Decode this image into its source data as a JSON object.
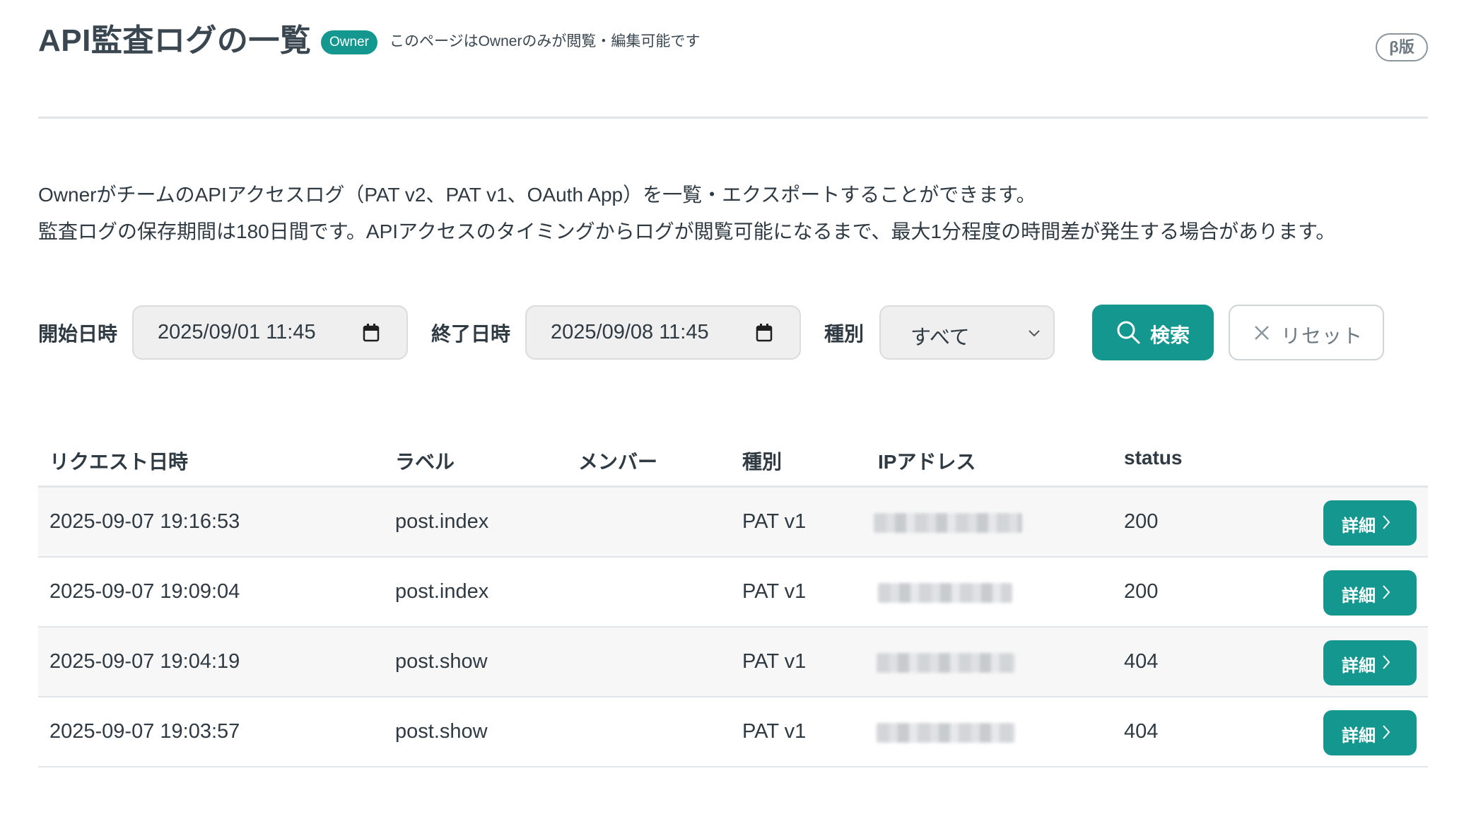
{
  "header": {
    "title": "API監査ログの一覧",
    "owner_badge": "Owner",
    "owner_note": "このページはOwnerのみが閲覧・編集可能です",
    "beta_badge": "β版"
  },
  "description": {
    "line1": "OwnerがチームのAPIアクセスログ（PAT v2、PAT v1、OAuth App）を一覧・エクスポートすることができます。",
    "line2": "監査ログの保存期間は180日間です。APIアクセスのタイミングからログが閲覧可能になるまで、最大1分程度の時間差が発生する場合があります。"
  },
  "filters": {
    "start_label": "開始日時",
    "start_value": "2025/09/01 11:45",
    "end_label": "終了日時",
    "end_value": "2025/09/08 11:45",
    "type_label": "種別",
    "type_value": "すべて",
    "search_label": "検索",
    "reset_label": "リセット"
  },
  "table": {
    "headers": {
      "datetime": "リクエスト日時",
      "label": "ラベル",
      "member": "メンバー",
      "type": "種別",
      "ip": "IPアドレス",
      "status": "status"
    },
    "rows": [
      {
        "datetime": "2025-09-07 19:16:53",
        "label": "post.index",
        "member": "",
        "type": "PAT v1",
        "status": "200",
        "detail": "詳細"
      },
      {
        "datetime": "2025-09-07 19:09:04",
        "label": "post.index",
        "member": "",
        "type": "PAT v1",
        "status": "200",
        "detail": "詳細"
      },
      {
        "datetime": "2025-09-07 19:04:19",
        "label": "post.show",
        "member": "",
        "type": "PAT v1",
        "status": "404",
        "detail": "詳細"
      },
      {
        "datetime": "2025-09-07 19:03:57",
        "label": "post.show",
        "member": "",
        "type": "PAT v1",
        "status": "404",
        "detail": "詳細"
      }
    ]
  },
  "colors": {
    "accent": "#14978e",
    "text": "#2f3a42",
    "divider": "#e3e6e8",
    "row_alt": "#f7f7f7"
  },
  "icons": {
    "calendar": "calendar-icon",
    "chevron": "chevron-down-icon",
    "search": "search-icon",
    "close": "close-icon",
    "arrow": "chevron-right-icon"
  }
}
